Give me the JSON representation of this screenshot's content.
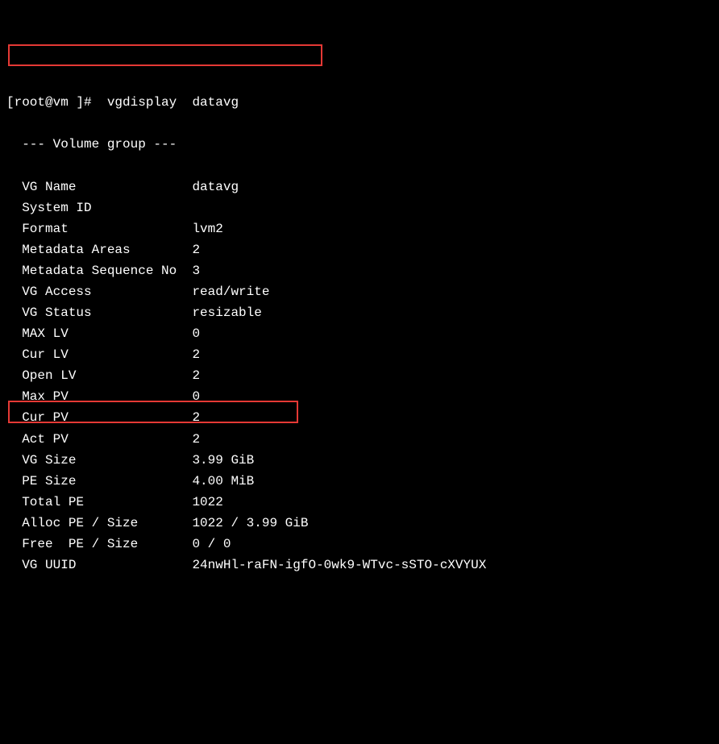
{
  "prompt": "[root@vm ]#  vgdisplay  datavg",
  "header": "  --- Volume group ---",
  "rows": [
    {
      "label": "  VG Name",
      "value": "datavg"
    },
    {
      "label": "  System ID",
      "value": ""
    },
    {
      "label": "  Format",
      "value": "lvm2"
    },
    {
      "label": "  Metadata Areas",
      "value": "2"
    },
    {
      "label": "  Metadata Sequence No",
      "value": "3"
    },
    {
      "label": "  VG Access",
      "value": "read/write"
    },
    {
      "label": "  VG Status",
      "value": "resizable"
    },
    {
      "label": "  MAX LV",
      "value": "0"
    },
    {
      "label": "  Cur LV",
      "value": "2"
    },
    {
      "label": "  Open LV",
      "value": "2"
    },
    {
      "label": "  Max PV",
      "value": "0"
    },
    {
      "label": "  Cur PV",
      "value": "2"
    },
    {
      "label": "  Act PV",
      "value": "2"
    },
    {
      "label": "  VG Size",
      "value": "3.99 GiB"
    },
    {
      "label": "  PE Size",
      "value": "4.00 MiB"
    },
    {
      "label": "  Total PE",
      "value": "1022"
    },
    {
      "label": "  Alloc PE / Size",
      "value": "1022 / 3.99 GiB"
    },
    {
      "label": "  Free  PE / Size",
      "value": "0 / 0"
    },
    {
      "label": "  VG UUID",
      "value": "24nwHl-raFN-igfO-0wk9-WTvc-sSTO-cXVYUX"
    }
  ],
  "highlights": {
    "vgname_row_index": 0,
    "freepe_row_index": 17
  }
}
